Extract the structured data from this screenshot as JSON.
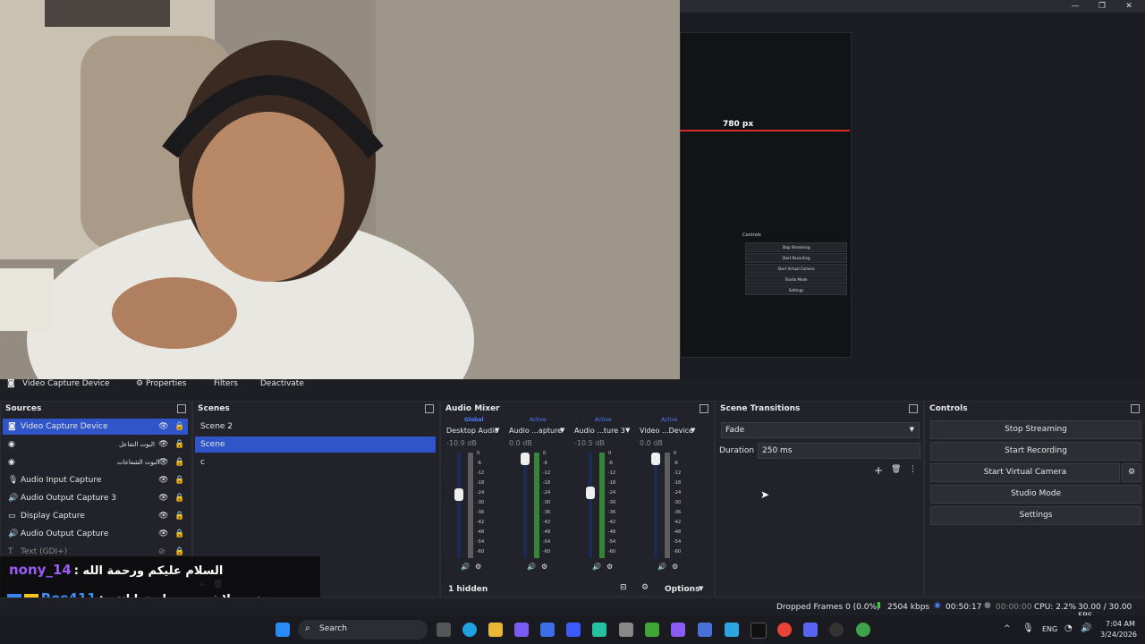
{
  "window": {
    "minimize": "—",
    "maximize": "❐",
    "close": "✕"
  },
  "preview": {
    "px_label": "780 px"
  },
  "sub_panel": {
    "title": "Controls",
    "buttons": [
      "Stop Streaming",
      "Start Recording",
      "Start Virtual Camera",
      "Studio Mode",
      "Settings"
    ]
  },
  "source_toolbar": {
    "name": "Video Capture Device",
    "properties": "Properties",
    "filters": "Filters",
    "deactivate": "Deactivate"
  },
  "sources": {
    "title": "Sources",
    "items": [
      {
        "label": "Video Capture Device",
        "icon": "camera-icon"
      },
      {
        "label": "البوت التفاعل",
        "icon": "globe-icon"
      },
      {
        "label": "البوت الشعاعات",
        "icon": "globe-icon"
      },
      {
        "label": "Audio Input Capture",
        "icon": "mic-icon"
      },
      {
        "label": "Audio Output Capture 3",
        "icon": "speaker-icon"
      },
      {
        "label": "Display Capture",
        "icon": "monitor-icon"
      },
      {
        "label": "Audio Output Capture",
        "icon": "speaker-icon"
      },
      {
        "label": "Text (GDI+)",
        "icon": "text-icon"
      }
    ]
  },
  "scenes": {
    "title": "Scenes",
    "items": [
      "Scene 2",
      "Scene",
      "c"
    ]
  },
  "mixer": {
    "title": "Audio Mixer",
    "channels": [
      {
        "tag": "Global",
        "name": "Desktop Audio",
        "db": "-10.9 dB",
        "volume": 0.6
      },
      {
        "tag": "Active",
        "name": "Audio ...apture",
        "db": "0.0 dB",
        "volume": 1.0
      },
      {
        "tag": "Active",
        "name": "Audio ...ture 3",
        "db": "-10.5 dB",
        "volume": 0.62
      },
      {
        "tag": "Active",
        "name": "Video ...Device",
        "db": "0.0 dB",
        "volume": 1.0
      }
    ],
    "scale": [
      "0",
      "-6",
      "-12",
      "-18",
      "-24",
      "-30",
      "-36",
      "-42",
      "-48",
      "-54",
      "-60"
    ],
    "hidden": "1 hidden",
    "options": "Options"
  },
  "transitions": {
    "title": "Scene Transitions",
    "type": "Fade",
    "duration_label": "Duration",
    "duration_value": "250 ms"
  },
  "controls": {
    "title": "Controls",
    "buttons": [
      "Stop Streaming",
      "Start Recording",
      "Start Virtual Camera",
      "Studio Mode",
      "Settings"
    ]
  },
  "status": {
    "dropped": "Dropped Frames 0 (0.0%)",
    "kbps": "2504 kbps",
    "stream_time": "00:50:17",
    "rec_time": "00:00:00",
    "cpu": "CPU: 2.2%",
    "fps": "30.00 / 30.00 FPS"
  },
  "chat": [
    {
      "user": "nony_14",
      "message": ": السلام عليكم ورحمة الله"
    },
    {
      "user": "Res411",
      "message": ": نت ببلاش بعد مدلعينها انتم"
    }
  ],
  "taskbar": {
    "search": "Search",
    "lang": "ENG",
    "time": "7:04 AM",
    "date": "3/24/2026"
  },
  "colors": {
    "accent": "#2f55c9",
    "live_red": "#d62b2b"
  }
}
